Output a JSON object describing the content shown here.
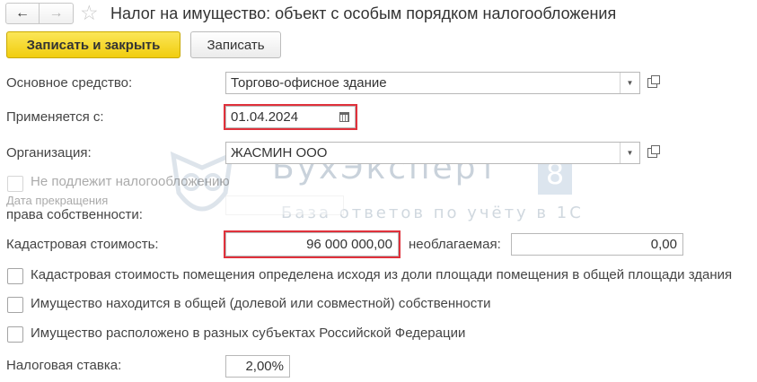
{
  "window": {
    "title": "Налог на имущество: объект с особым порядком налогообложения",
    "back_icon": "arrow-left-icon",
    "forward_icon": "arrow-right-icon",
    "favorite_icon": "star-icon"
  },
  "toolbar": {
    "save_close_label": "Записать и закрыть",
    "save_label": "Записать"
  },
  "form": {
    "asset": {
      "label": "Основное средство:",
      "value": "Торгово-офисное здание"
    },
    "applies_from": {
      "label": "Применяется с:",
      "value": "01.04.2024"
    },
    "organization": {
      "label": "Организация:",
      "value": "ЖАСМИН ООО"
    },
    "not_taxable": {
      "label": "Не подлежит налогообложению",
      "checked": false
    },
    "ownership_end": {
      "label_line1": "Дата прекращения",
      "label_line2": "права собственности:",
      "value": ""
    },
    "cadastral_value": {
      "label": "Кадастровая стоимость:",
      "value": "96 000 000,00"
    },
    "non_taxable": {
      "label": "необлагаемая:",
      "value": "0,00"
    },
    "checkboxes": [
      {
        "label": "Кадастровая стоимость помещения определена исходя из доли площади помещения в общей площади здания",
        "checked": false
      },
      {
        "label": "Имущество находится в общей (долевой или совместной) собственности",
        "checked": false
      },
      {
        "label": "Имущество расположено в разных субъектах Российской Федерации",
        "checked": false
      }
    ],
    "tax_rate": {
      "label": "Налоговая ставка:",
      "value": "2,00%"
    }
  },
  "watermark": {
    "title": "БухЭксперт",
    "badge": "8",
    "subtitle": "База ответов по учёту в 1С"
  },
  "colors": {
    "primary_button": "#f1cd0e",
    "highlight": "#e0313b",
    "watermark": "#c9d2db"
  }
}
